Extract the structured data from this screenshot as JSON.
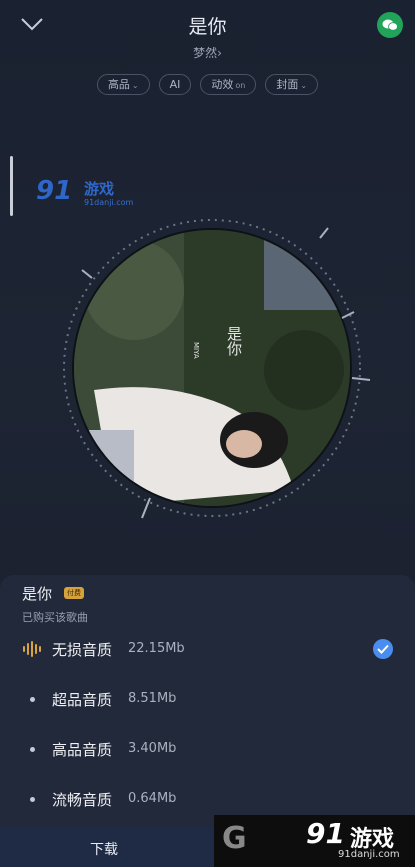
{
  "header": {
    "title": "是你",
    "artist": "梦然",
    "chevron_right": "›",
    "chips": [
      {
        "label": "高品",
        "suffix": "⌄"
      },
      {
        "label": "AI",
        "suffix": ""
      },
      {
        "label": "动效",
        "suffix": "on"
      },
      {
        "label": "封面",
        "suffix": "⌄"
      }
    ]
  },
  "icons": {
    "collapse": "chevron-down-icon",
    "share": "wechat-icon",
    "quality_wave": "waveform-icon",
    "check": "check-icon"
  },
  "watermark_top": {
    "brand": "91",
    "text": "游戏",
    "url": "91danji.com"
  },
  "cover_text": {
    "line1": "是你",
    "line2": "MIYA"
  },
  "sheet": {
    "title": "是你",
    "badge": "付费",
    "purchased": "已购买该歌曲",
    "qualities": [
      {
        "label": "无损音质",
        "size": "22.15Mb",
        "selected": true
      },
      {
        "label": "超品音质",
        "size": "8.51Mb",
        "selected": false
      },
      {
        "label": "高品音质",
        "size": "3.40Mb",
        "selected": false
      },
      {
        "label": "流畅音质",
        "size": "0.64Mb",
        "selected": false
      }
    ],
    "download": "下载"
  },
  "watermark_bottom": {
    "logo": "G",
    "brand": "91",
    "text": "游戏",
    "url": "91danji.com"
  },
  "colors": {
    "accent": "#4a8df0",
    "gold": "#d6a23b",
    "wechat": "#22a35a",
    "bg": "#1c2332",
    "sheet": "#22293a"
  }
}
